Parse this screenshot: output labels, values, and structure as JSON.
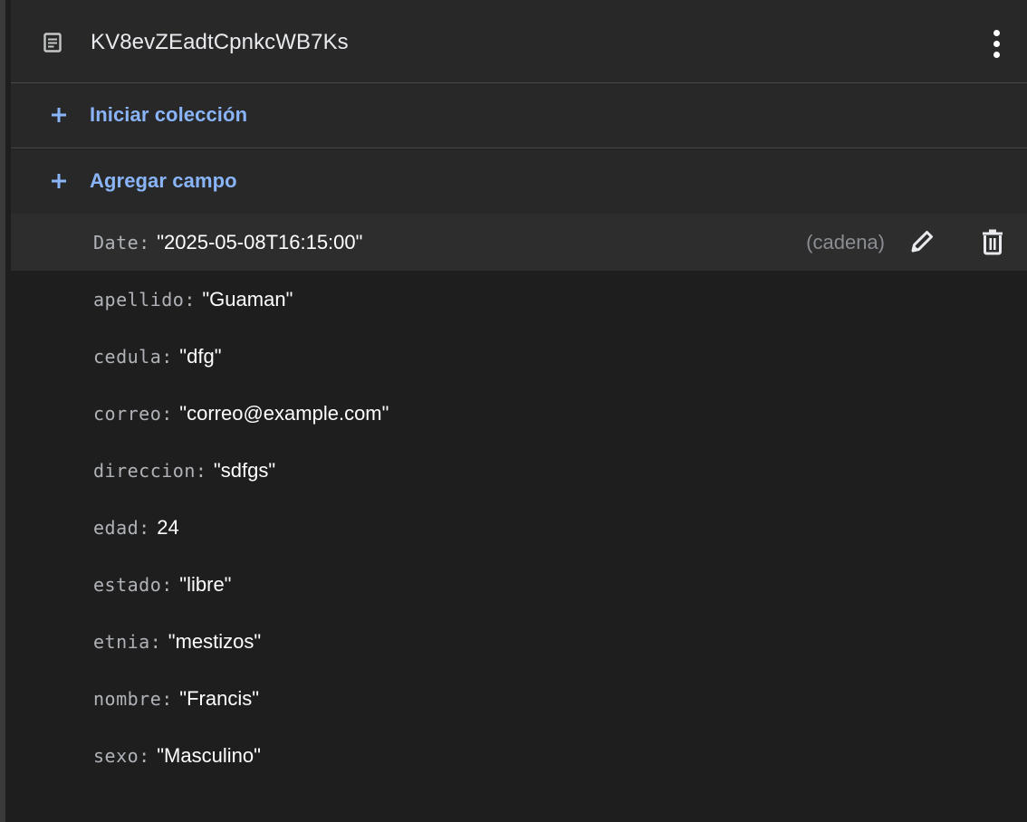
{
  "document": {
    "id": "KV8evZEadtCpnkcWB7Ks",
    "icon": "document-icon",
    "more_icon": "more-vertical-icon"
  },
  "actions": {
    "start_collection": "Iniciar colección",
    "add_field": "Agregar campo",
    "plus_icon": "plus-icon"
  },
  "fields": [
    {
      "key": "Date",
      "value": "\"2025-05-08T16:15:00\"",
      "type": "(cadena)",
      "highlighted": true
    },
    {
      "key": "apellido",
      "value": "\"Guaman\""
    },
    {
      "key": "cedula",
      "value": "\"dfg\""
    },
    {
      "key": "correo",
      "value": "\"correo@example.com\""
    },
    {
      "key": "direccion",
      "value": "\"sdfgs\""
    },
    {
      "key": "edad",
      "value": "24"
    },
    {
      "key": "estado",
      "value": "\"libre\""
    },
    {
      "key": "etnia",
      "value": "\"mestizos\""
    },
    {
      "key": "nombre",
      "value": "\"Francis\""
    },
    {
      "key": "sexo",
      "value": "\"Masculino\""
    }
  ],
  "field_separator": ":",
  "row_tools": {
    "edit_icon": "pencil-icon",
    "delete_icon": "trash-icon"
  },
  "colors": {
    "background": "#1e1e1e",
    "header_bg": "#282828",
    "accent": "#8ab4f8",
    "key_text": "#b0b3b8",
    "value_text": "#ffffff"
  }
}
